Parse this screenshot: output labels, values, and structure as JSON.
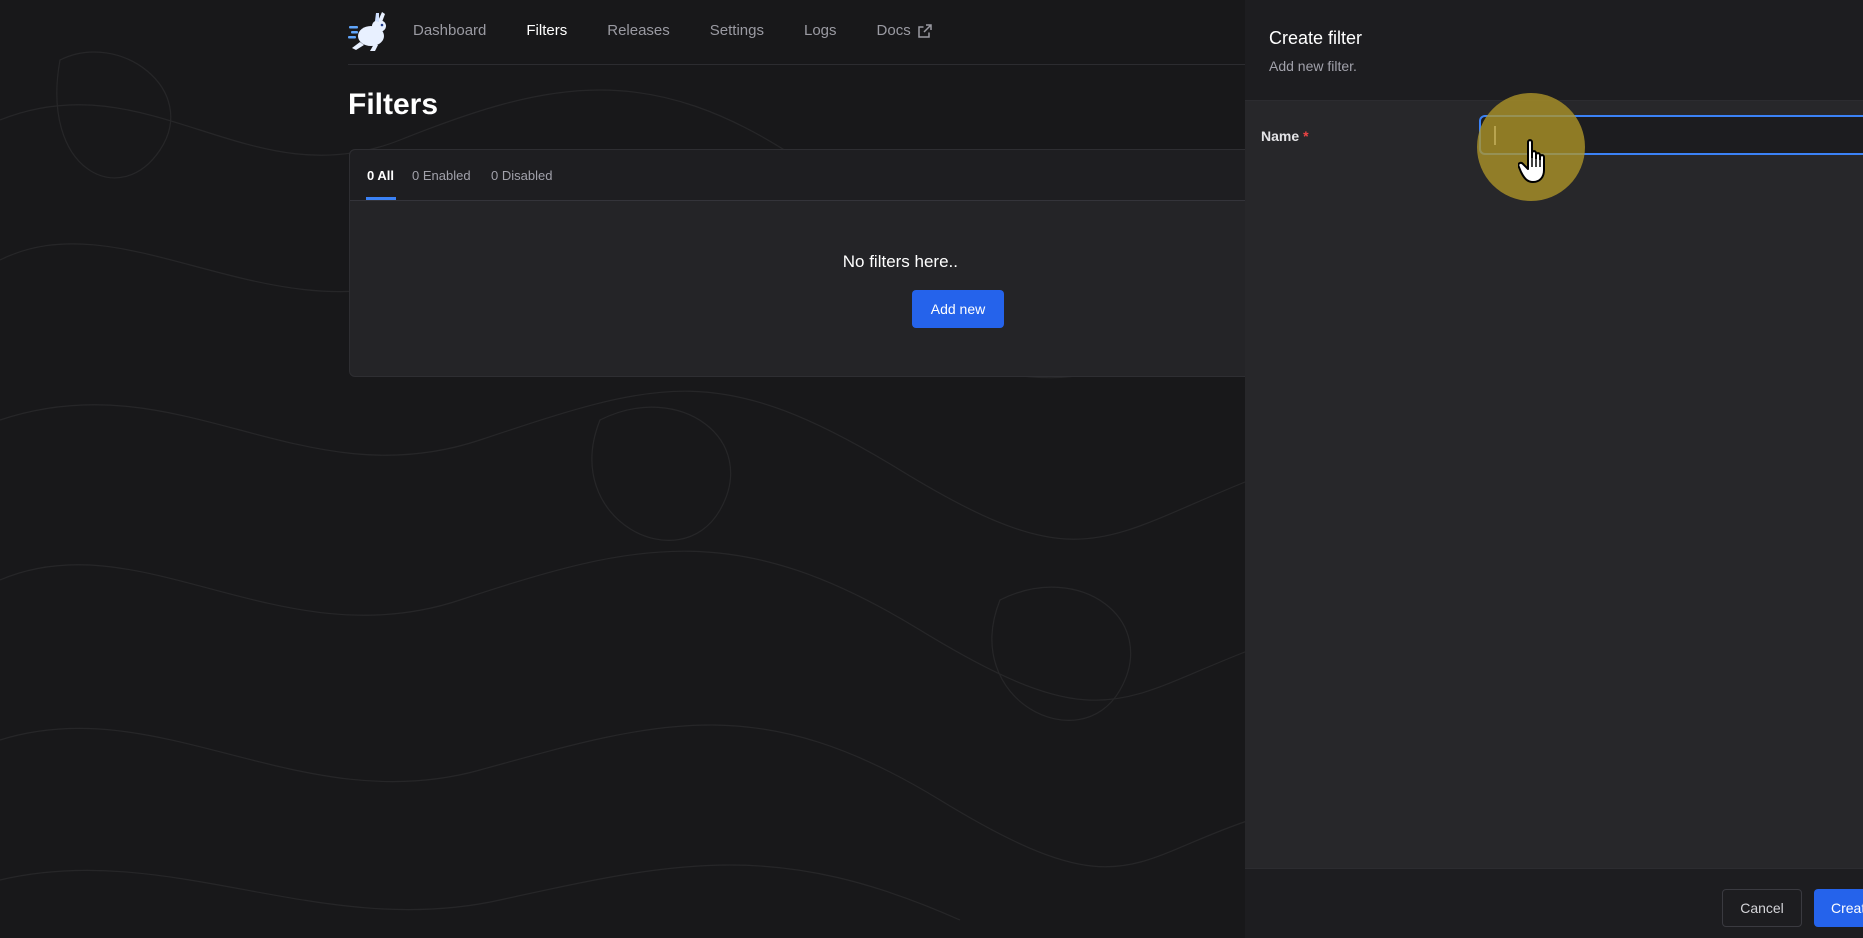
{
  "nav": {
    "items": [
      {
        "label": "Dashboard",
        "active": false
      },
      {
        "label": "Filters",
        "active": true
      },
      {
        "label": "Releases",
        "active": false
      },
      {
        "label": "Settings",
        "active": false
      },
      {
        "label": "Logs",
        "active": false
      },
      {
        "label": "Docs",
        "active": false,
        "external": true
      }
    ]
  },
  "page": {
    "title": "Filters"
  },
  "tabs": [
    {
      "label": "0 All",
      "active": true
    },
    {
      "label": "0 Enabled",
      "active": false
    },
    {
      "label": "0 Disabled",
      "active": false
    }
  ],
  "empty": {
    "message": "No filters here..",
    "add_label": "Add new"
  },
  "drawer": {
    "title": "Create filter",
    "subtitle": "Add new filter.",
    "name_label": "Name",
    "required_mark": "*",
    "name_value": "",
    "cancel_label": "Cancel",
    "create_label": "Create"
  },
  "colors": {
    "accent": "#2563eb",
    "focus": "#3b82f6",
    "required": "#ef4444",
    "click_highlight": "#b09628"
  },
  "icons": {
    "logo": "rabbit-logo-icon",
    "external": "external-link-icon",
    "pointer": "hand-pointer-icon"
  }
}
